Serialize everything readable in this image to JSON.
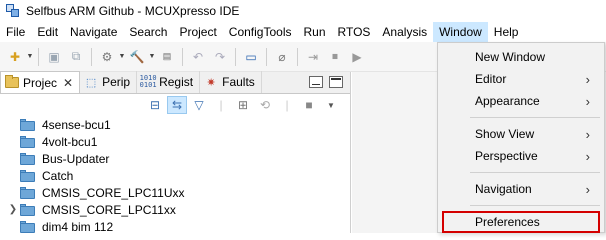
{
  "window": {
    "title": "Selfbus ARM Github - MCUXpresso IDE"
  },
  "menubar": {
    "items": [
      "File",
      "Edit",
      "Navigate",
      "Search",
      "Project",
      "ConfigTools",
      "Run",
      "RTOS",
      "Analysis",
      "Window",
      "Help"
    ],
    "active": "Window"
  },
  "toolbar": {
    "icons": [
      "new-icon",
      "save-icon",
      "save-all-icon",
      "debug-icon",
      "build-icon",
      "binary-icon",
      "undo-icon",
      "redo-icon",
      "console-icon",
      "pin-icon",
      "skip-icon",
      "stop-icon",
      "run-icon"
    ]
  },
  "view_tabs": [
    {
      "label": "Projec",
      "icon": "folder-icon",
      "active": true
    },
    {
      "label": "Perip",
      "icon": "peripheral-icon",
      "active": false
    },
    {
      "label": "Regist",
      "icon": "registers-icon",
      "active": false
    },
    {
      "label": "Faults",
      "icon": "bug-icon",
      "active": false
    }
  ],
  "tree": {
    "items": [
      {
        "label": "4sense-bcu1",
        "expandable": false
      },
      {
        "label": "4volt-bcu1",
        "expandable": false
      },
      {
        "label": "Bus-Updater",
        "expandable": false
      },
      {
        "label": "Catch",
        "expandable": false
      },
      {
        "label": "CMSIS_CORE_LPC11Uxx",
        "expandable": false
      },
      {
        "label": "CMSIS_CORE_LPC11xx",
        "expandable": true
      },
      {
        "label": "dim4 bim 112",
        "expandable": false
      }
    ]
  },
  "window_menu": {
    "items": [
      {
        "label": "New Window",
        "submenu": false
      },
      {
        "label": "Editor",
        "submenu": true
      },
      {
        "label": "Appearance",
        "submenu": true
      },
      {
        "label": "Show View",
        "submenu": true
      },
      {
        "label": "Perspective",
        "submenu": true
      },
      {
        "label": "Navigation",
        "submenu": true
      },
      {
        "label": "Preferences",
        "submenu": false,
        "highlighted": true
      }
    ]
  },
  "colors": {
    "menu_highlight": "#cce8ff",
    "callout_border": "#d40000"
  }
}
